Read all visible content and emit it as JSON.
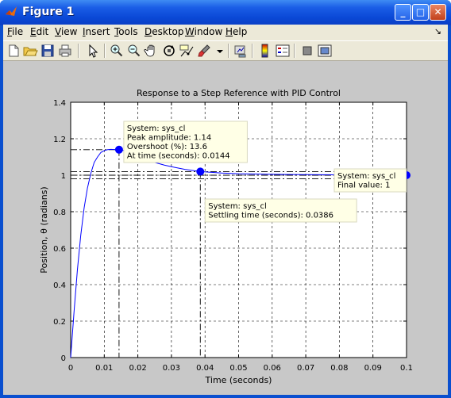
{
  "window": {
    "title": "Figure 1"
  },
  "title_buttons": {
    "minimize": "_",
    "maximize": "□",
    "close": "✕"
  },
  "menu": [
    {
      "label": "File",
      "underline": "F",
      "rest": "ile"
    },
    {
      "label": "Edit",
      "underline": "E",
      "rest": "dit"
    },
    {
      "label": "View",
      "underline": "V",
      "rest": "iew"
    },
    {
      "label": "Insert",
      "underline": "I",
      "rest": "nsert"
    },
    {
      "label": "Tools",
      "underline": "T",
      "rest": "ools"
    },
    {
      "label": "Desktop",
      "underline": "D",
      "rest": "esktop"
    },
    {
      "label": "Window",
      "underline": "W",
      "rest": "indow"
    },
    {
      "label": "Help",
      "underline": "H",
      "rest": "elp"
    }
  ],
  "menu_arrow": "↘",
  "toolbar_icons": [
    "new-figure-icon",
    "open-file-icon",
    "save-icon",
    "print-icon",
    "edit-plot-arrow-icon",
    "zoom-in-icon",
    "zoom-out-icon",
    "pan-hand-icon",
    "rotate-3d-icon",
    "data-cursor-icon",
    "brush-icon",
    "brush-dropdown-icon",
    "link-plot-icon",
    "colorbar-icon",
    "legend-icon",
    "hide-plot-tools-icon",
    "show-plot-tools-icon"
  ],
  "chart_data": {
    "type": "line",
    "title": "Response to a Step Reference with PID Control",
    "xlabel": "Time (seconds)",
    "ylabel": "Position, θ (radians)",
    "xlim": [
      0,
      0.1
    ],
    "ylim": [
      0,
      1.4
    ],
    "xticks": [
      "0",
      "0.01",
      "0.02",
      "0.03",
      "0.04",
      "0.05",
      "0.06",
      "0.07",
      "0.08",
      "0.09",
      "0.1"
    ],
    "yticks": [
      "0",
      "0.2",
      "0.4",
      "0.6",
      "0.8",
      "1",
      "1.2",
      "1.4"
    ],
    "grid": true,
    "series": [
      {
        "color": "#0000ff",
        "x": [
          0,
          0.001,
          0.002,
          0.003,
          0.004,
          0.005,
          0.006,
          0.007,
          0.008,
          0.009,
          0.01,
          0.011,
          0.012,
          0.013,
          0.0144,
          0.016,
          0.018,
          0.02,
          0.022,
          0.025,
          0.028,
          0.031,
          0.034,
          0.0386,
          0.045,
          0.05,
          0.06,
          0.07,
          0.08,
          0.09,
          0.1
        ],
        "y": [
          0,
          0.25,
          0.48,
          0.67,
          0.82,
          0.93,
          1.01,
          1.07,
          1.1,
          1.125,
          1.135,
          1.14,
          1.142,
          1.141,
          1.14,
          1.135,
          1.12,
          1.105,
          1.09,
          1.07,
          1.055,
          1.043,
          1.032,
          1.02,
          1.012,
          1.008,
          1.005,
          1.003,
          1.002,
          1.001,
          1.0
        ]
      }
    ],
    "markers": [
      {
        "x": 0.0144,
        "y": 1.14
      },
      {
        "x": 0.0386,
        "y": 1.02
      },
      {
        "x": 0.1,
        "y": 1.0
      }
    ],
    "datatips": [
      {
        "lines": [
          "System: sys_cl",
          "Peak amplitude: 1.14",
          "Overshoot (%): 13.6",
          "At time (seconds): 0.0144"
        ]
      },
      {
        "lines": [
          "System: sys_cl",
          "Settling time (seconds): 0.0386"
        ]
      },
      {
        "lines": [
          "System: sys_cl",
          "Final value: 1"
        ]
      }
    ]
  }
}
